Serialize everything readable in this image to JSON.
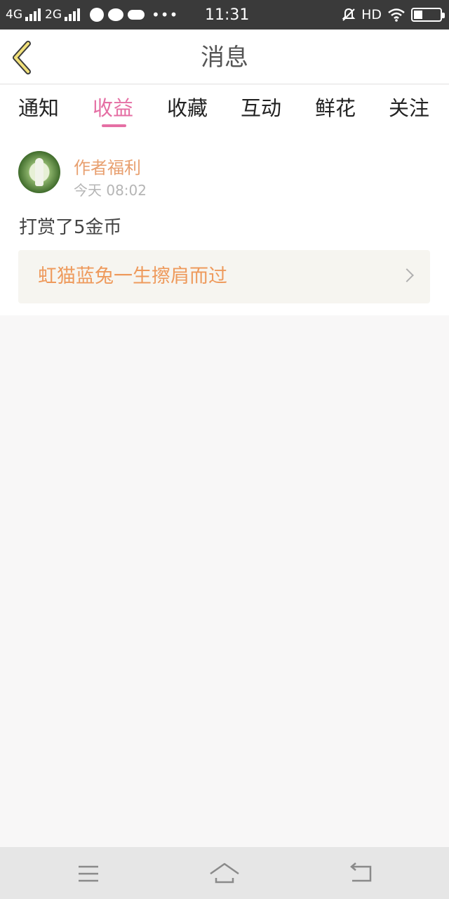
{
  "status_bar": {
    "network1": "4G",
    "network2": "2G",
    "dots": "•••",
    "time": "11:31",
    "hd": "HD"
  },
  "header": {
    "title": "消息"
  },
  "tabs": [
    {
      "label": "通知",
      "active": false
    },
    {
      "label": "收益",
      "active": true
    },
    {
      "label": "收藏",
      "active": false
    },
    {
      "label": "互动",
      "active": false
    },
    {
      "label": "鲜花",
      "active": false
    },
    {
      "label": "关注",
      "active": false
    }
  ],
  "message": {
    "sender": "作者福利",
    "time": "今天 08:02",
    "content": "打赏了5金币",
    "link_title": "虹猫蓝兔一生擦肩而过"
  },
  "colors": {
    "accent": "#e56fa4",
    "sender": "#e8a070",
    "link": "#ee9a5c"
  }
}
